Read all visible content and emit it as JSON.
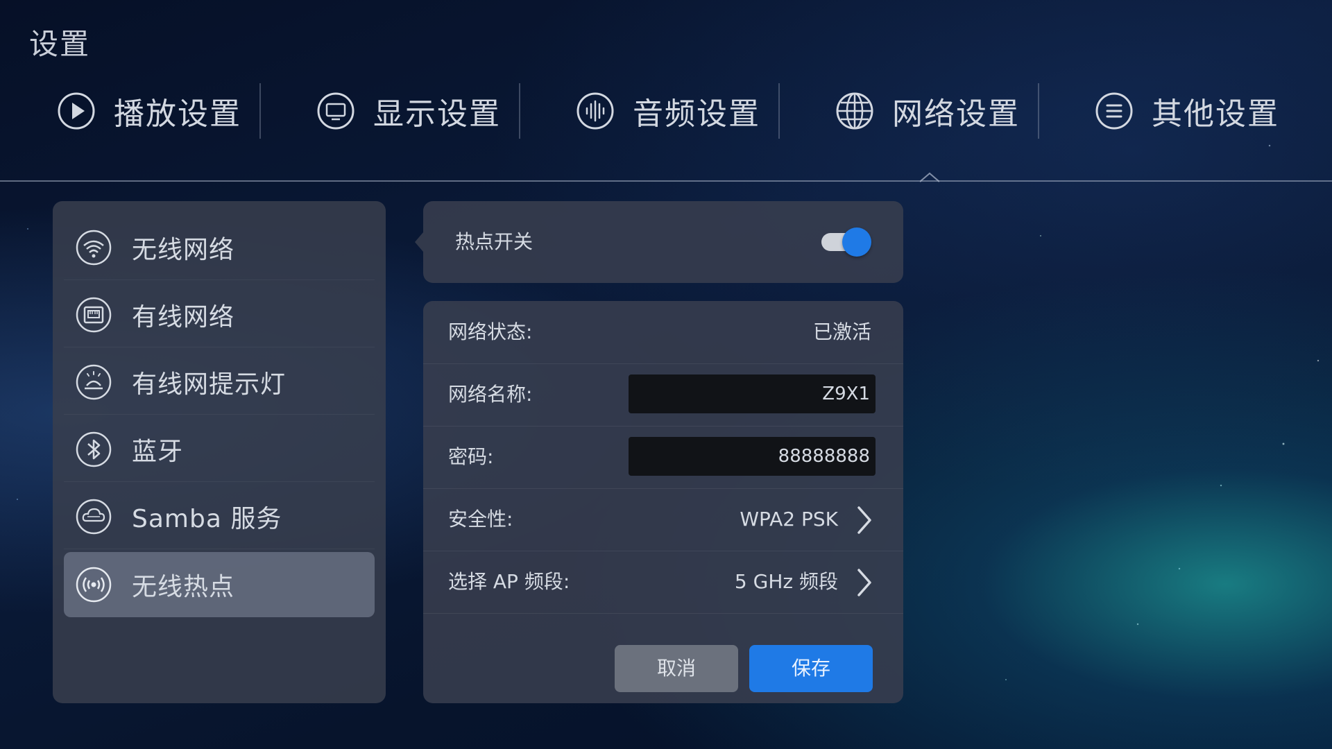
{
  "page": {
    "title": "设置"
  },
  "top_tabs": [
    {
      "label": "播放设置",
      "icon": "play-circle-icon"
    },
    {
      "label": "显示设置",
      "icon": "monitor-icon"
    },
    {
      "label": "音频设置",
      "icon": "audio-waveform-icon"
    },
    {
      "label": "网络设置",
      "icon": "globe-icon",
      "active": true
    },
    {
      "label": "其他设置",
      "icon": "menu-lines-icon"
    }
  ],
  "sidebar": {
    "items": [
      {
        "label": "无线网络",
        "icon": "wifi-icon"
      },
      {
        "label": "有线网络",
        "icon": "ethernet-port-icon"
      },
      {
        "label": "有线网提示灯",
        "icon": "indicator-light-icon"
      },
      {
        "label": "蓝牙",
        "icon": "bluetooth-icon"
      },
      {
        "label": "Samba 服务",
        "icon": "samba-cloud-icon"
      },
      {
        "label": "无线热点",
        "icon": "hotspot-broadcast-icon",
        "active": true
      }
    ]
  },
  "hotspot": {
    "label": "热点开关",
    "enabled": true
  },
  "form": {
    "status_label": "网络状态:",
    "status_value": "已激活",
    "name_label": "网络名称:",
    "name_value": "Z9X1",
    "password_label": "密码:",
    "password_value": "88888888",
    "security_label": "安全性:",
    "security_value": "WPA2 PSK",
    "band_label": "选择 AP 频段:",
    "band_value": "5 GHz 频段",
    "cancel_label": "取消",
    "save_label": "保存"
  },
  "colors": {
    "accent": "#1f7ae6",
    "panel": "#383e4e",
    "active_item": "#6e7688"
  }
}
